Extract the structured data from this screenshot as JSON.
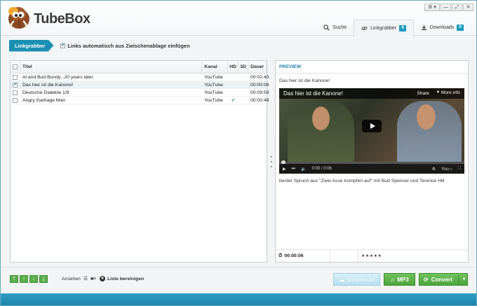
{
  "app": {
    "title": "TubeBox"
  },
  "window_controls": [
    "⚙ ▾",
    "—",
    "⤢",
    "✕"
  ],
  "tabs": [
    {
      "label": "Suche",
      "icon": "search-icon"
    },
    {
      "label": "Linkgrabber",
      "icon": "link-icon",
      "badge": "4"
    },
    {
      "label": "Downloads",
      "icon": "download-icon",
      "badge": "0"
    }
  ],
  "toolbar": {
    "section_label": "Linkgrabber",
    "auto_clipboard_label": "Links automatisch aus Zwischenablage einfügen",
    "auto_clipboard_checked": true
  },
  "list": {
    "columns": [
      "Titel",
      "Kanal",
      "HD",
      "3D",
      "Dauer"
    ],
    "rows": [
      {
        "title": "Al and Bud Bundy...20 years later",
        "channel": "YouTube",
        "hd": "",
        "threed": "",
        "duration": "00:02:40",
        "checked": false
      },
      {
        "title": "Das hier ist die Kanone!",
        "channel": "YouTube",
        "hd": "",
        "threed": "",
        "duration": "00:00:06",
        "checked": true
      },
      {
        "title": "Deutsche Dialekte 1/9",
        "channel": "YouTube",
        "hd": "",
        "threed": "",
        "duration": "00:09:59",
        "checked": false
      },
      {
        "title": "Angry Garbage Man",
        "channel": "YouTube",
        "hd": "✔",
        "threed": "",
        "duration": "00:00:48",
        "checked": false
      }
    ]
  },
  "preview": {
    "header": "PREVIEW",
    "name": "Das hier ist die Kanone!",
    "video": {
      "title": "Das hier ist die Kanone!",
      "share_label": "Share",
      "more_info_label": "More info",
      "time": "0:00 / 0:06",
      "progress": 0
    },
    "description": "bester Spruch aus \"Zwei Asse trumpfen auf\" mit Bud Spencer und Terence Hill",
    "duration": "00:00:06",
    "rating": "★★★★★"
  },
  "bottom": {
    "view_label": "Ansehen",
    "clear_label": "Liste bereinigen",
    "download_label": "Download",
    "mp3_label": "MP3",
    "convert_label": "Convert"
  },
  "colors": {
    "accent": "#1a9bbd",
    "green": "#5ab04a",
    "footer": "#2390b8"
  }
}
